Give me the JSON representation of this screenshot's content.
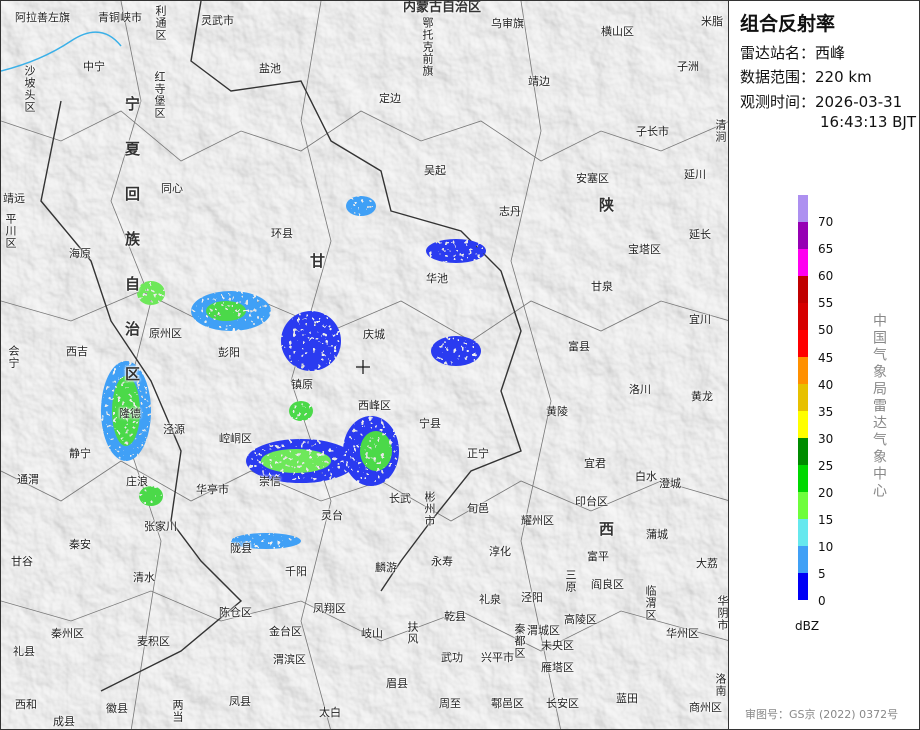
{
  "panel": {
    "title": "组合反射率",
    "station_label": "雷达站名：",
    "station": "西峰",
    "range_label": "数据范围：",
    "range": "220 km",
    "time_label": "观测时间：",
    "date": "2026-03-31",
    "time": "16:43:13 BJT",
    "legend": {
      "unit": "dBZ",
      "ticks": [
        "70",
        "65",
        "60",
        "55",
        "50",
        "45",
        "40",
        "35",
        "30",
        "25",
        "20",
        "15",
        "10",
        "5",
        "0"
      ],
      "colors": [
        "#ad90f0",
        "#9600b4",
        "#ff00f0",
        "#c00000",
        "#d60000",
        "#ff0000",
        "#ff9000",
        "#e7c000",
        "#ffff00",
        "#008c00",
        "#00d800",
        "#6efe3c",
        "#66e8ee",
        "#40a0f6",
        "#0000f6"
      ]
    },
    "agency": "中国气象局雷达气象中心",
    "approval": "审图号：GS京 (2022) 0372号"
  },
  "map": {
    "radar_site_marker": "crosshair-icon",
    "province_labels": [
      "宁",
      "夏",
      "回",
      "族",
      "自",
      "治",
      "区",
      "甘",
      "陕",
      "西",
      "内蒙古自治区"
    ],
    "labels": [
      "阿拉善左旗",
      "青铜峡市",
      "利通区",
      "灵武市",
      "鄂托克前旗",
      "乌审旗",
      "米脂",
      "横山区",
      "盐池",
      "沙坡头区",
      "中宁",
      "红寺堡区",
      "定边",
      "靖边",
      "子洲",
      "子长市",
      "清涧",
      "同心",
      "吴起",
      "安塞区",
      "延川",
      "志丹",
      "延长",
      "宝塔区",
      "靖远",
      "平川区",
      "海原",
      "环县",
      "华池",
      "甘泉",
      "原州区",
      "彭阳",
      "庆城",
      "宜川",
      "富县",
      "会宁",
      "西吉",
      "镇原",
      "西峰区",
      "洛川",
      "黄龙",
      "隆德",
      "泾源",
      "崆峒区",
      "宁县",
      "黄陵",
      "静宁",
      "正宁",
      "宜君",
      "白水",
      "通渭",
      "庄浪",
      "华亭市",
      "崇信",
      "长武",
      "彬州市",
      "旬邑",
      "印台区",
      "澄城",
      "耀州区",
      "张家川",
      "灵台",
      "蒲城",
      "秦安",
      "陇县",
      "淳化",
      "富平",
      "大荔",
      "甘谷",
      "千阳",
      "麟游",
      "永寿",
      "清水",
      "三原",
      "阎良区",
      "临渭区",
      "华阴市",
      "陈仓区",
      "凤翔区",
      "乾县",
      "礼泉",
      "泾阳",
      "秦州区",
      "麦积区",
      "金台区",
      "岐山",
      "扶风",
      "秦都区",
      "渭城区",
      "高陵区",
      "华州区",
      "礼县",
      "渭滨区",
      "武功",
      "兴平市",
      "未央区",
      "雁塔区",
      "眉县",
      "周至",
      "鄠邑区",
      "长安区",
      "蓝田",
      "西和",
      "成县",
      "徽县",
      "两当",
      "凤县",
      "太白",
      "商州区",
      "洛南"
    ]
  }
}
